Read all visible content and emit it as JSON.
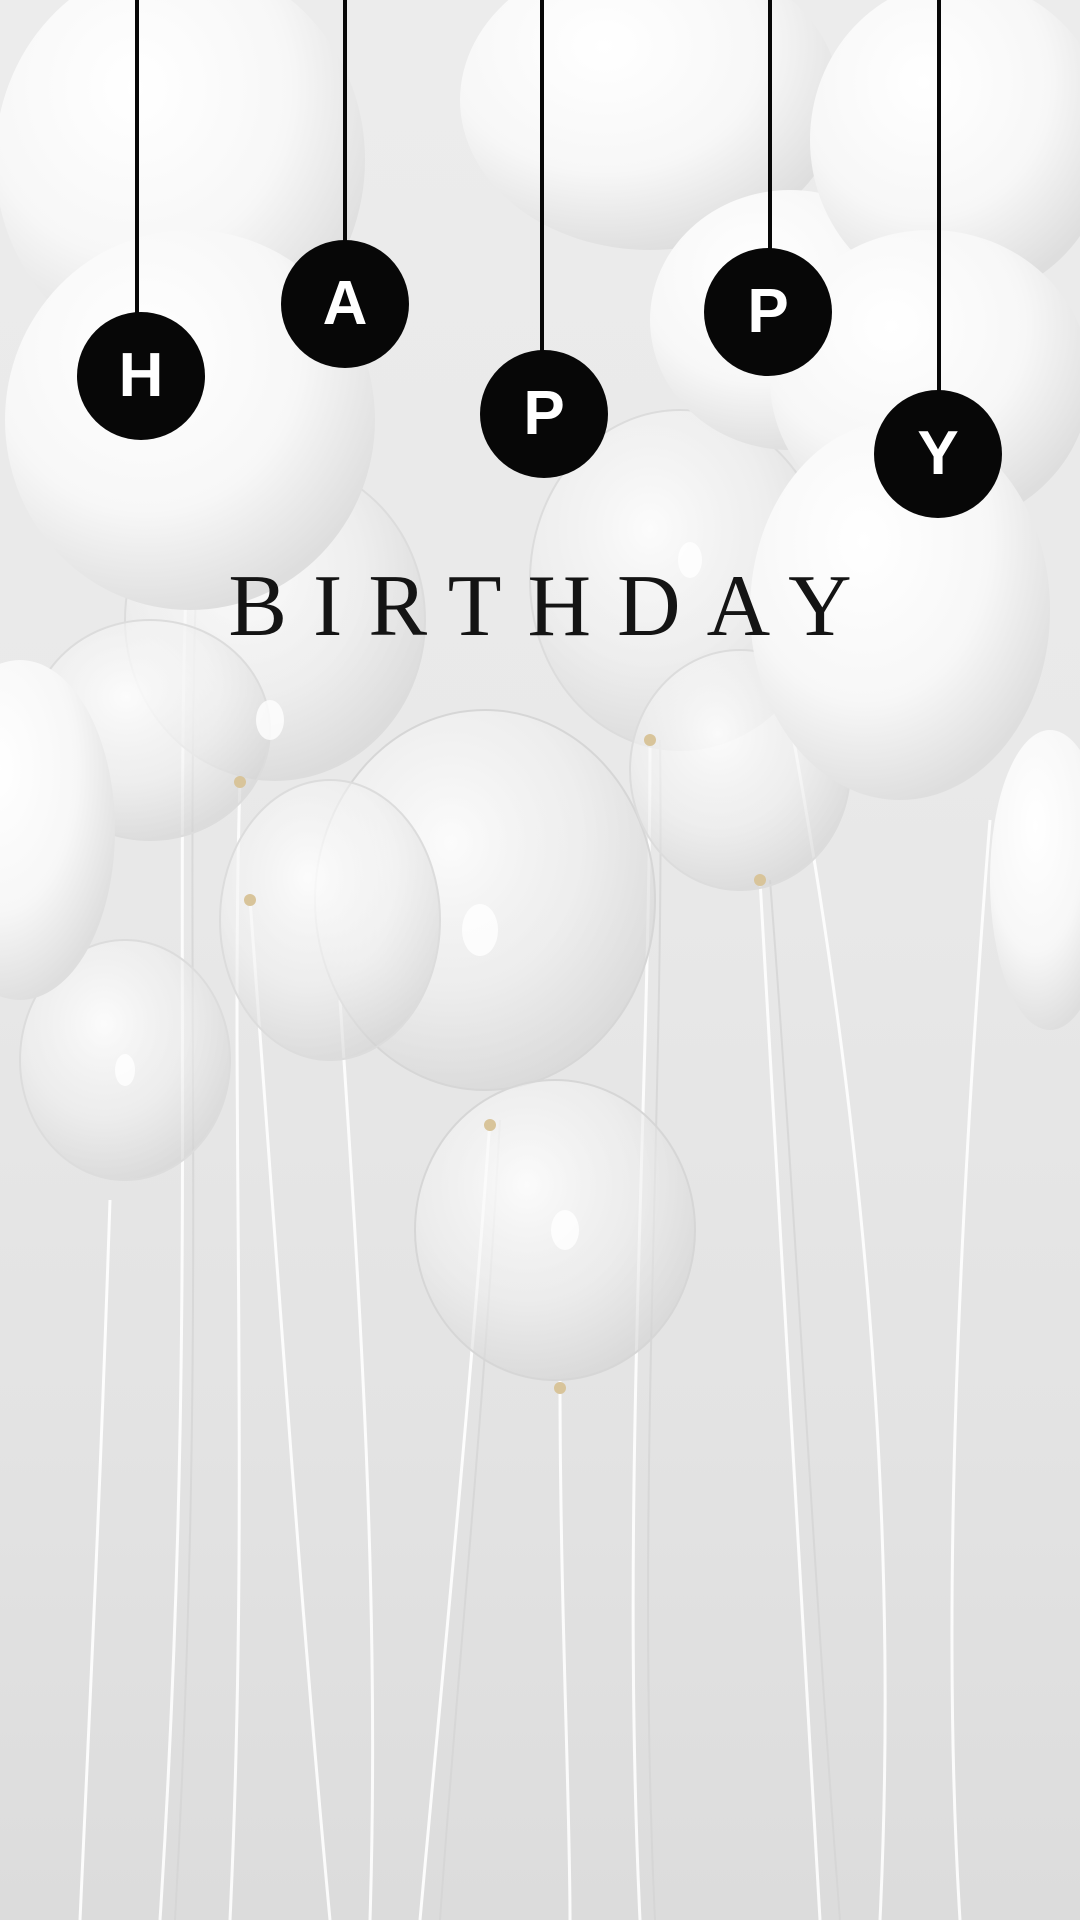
{
  "greeting": {
    "letters": [
      "H",
      "A",
      "P",
      "P",
      "Y"
    ],
    "title": "BIRTHDAY"
  },
  "colors": {
    "disc": "#070707",
    "disc_text": "#ffffff",
    "title": "#141414",
    "background": "#e8e8e8",
    "balloon": "#ffffff"
  },
  "icons": {
    "background": "white-balloons-illustration"
  }
}
